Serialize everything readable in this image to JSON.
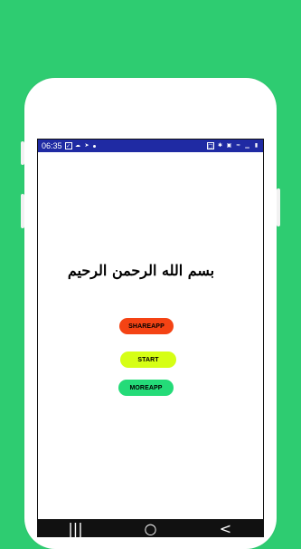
{
  "status_bar": {
    "time": "06:35",
    "left_icons": [
      "message-icon",
      "cloud-icon",
      "send-icon",
      "dot-icon"
    ],
    "right_icons": [
      "phone-status-icon",
      "bluetooth-icon",
      "vibrate-icon",
      "wifi-icon",
      "signal-icon",
      "battery-icon"
    ]
  },
  "content": {
    "bismillah": "بسم الله الرحمن الرحيم"
  },
  "buttons": {
    "share": "SHAREAPP",
    "start": "START",
    "more": "MOREAPP"
  },
  "navigation": {
    "recent_symbol": "|||",
    "home_symbol": "○",
    "back_symbol": "<"
  },
  "colors": {
    "background": "#2ecc71",
    "status_bar": "#1f2aa3",
    "share_button": "#f44314",
    "start_button": "#d6ff15",
    "more_button": "#24db78",
    "nav_bar": "#111111"
  }
}
